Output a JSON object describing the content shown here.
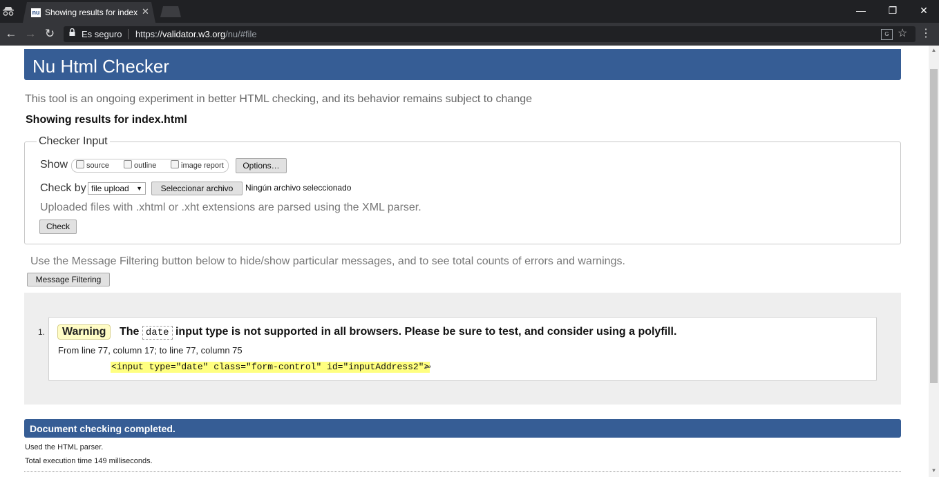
{
  "browser": {
    "tab_title": "Showing results for index.html",
    "tab_favicon_text": "nu",
    "secure_label": "Es seguro",
    "url_scheme": "https://",
    "url_host": "validator.w3.org",
    "url_path": "/nu/#file",
    "icons": [
      "incognito-icon",
      "close-icon",
      "back-icon",
      "forward-icon",
      "reload-icon",
      "lock-icon",
      "translate-icon",
      "star-icon",
      "menu-icon",
      "minimize-icon",
      "maximize-icon",
      "window-close-icon"
    ]
  },
  "page": {
    "title": "Nu Html Checker",
    "intro": "This tool is an ongoing experiment in better HTML checking, and its behavior remains subject to change",
    "results_for": "Showing results for index.html",
    "checker": {
      "legend": "Checker Input",
      "show_label": "Show",
      "options": [
        "source",
        "outline",
        "image report"
      ],
      "options_button": "Options…",
      "check_by_label": "Check by",
      "check_by_value": "file upload",
      "file_button": "Seleccionar archivo",
      "no_file": "Ningún archivo seleccionado",
      "upload_note": "Uploaded files with .xhtml or .xht extensions are parsed using the XML parser.",
      "check_button": "Check"
    },
    "filtering_note": "Use the Message Filtering button below to hide/show particular messages, and to see total counts of errors and warnings.",
    "filtering_button": "Message Filtering",
    "messages": [
      {
        "number": "1.",
        "type": "Warning",
        "text_before": "The",
        "code_term": "date",
        "text_after": "input type is not supported in all browsers. Please be sure to test, and consider using a polyfill.",
        "location": "From line 77, column 17; to line 77, column 75",
        "extract": "<input type=\"date\" class=\"form-control\" id=\"inputAddress2\">",
        "return_glyph": "↩"
      }
    ],
    "completed": "Document checking completed.",
    "parser_note": "Used the HTML parser.",
    "execution_time": "Total execution time 149 milliseconds."
  },
  "colors": {
    "header_blue": "#365d95",
    "warning_badge": "#fffcc5",
    "code_highlight": "#ffff80",
    "results_background": "#eeeeee"
  }
}
